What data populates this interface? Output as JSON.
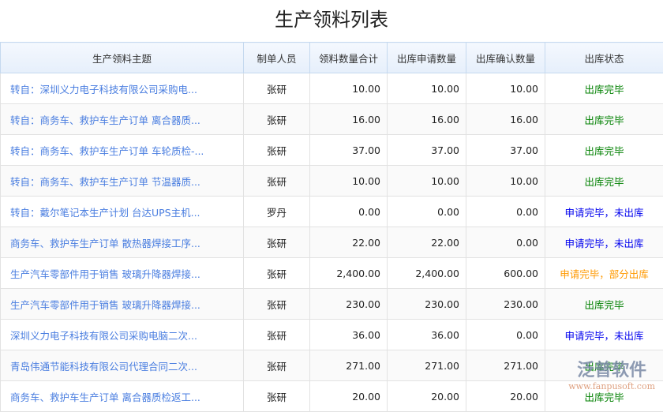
{
  "title": "生产领料列表",
  "columns": [
    "生产领料主题",
    "制单人员",
    "领料数量合计",
    "出库申请数量",
    "出库确认数量",
    "出库状态"
  ],
  "status_colors": {
    "出库完毕": "#008000",
    "申请完毕，未出库": "#0000ee",
    "申请完毕，部分出库": "#ff9900"
  },
  "rows": [
    {
      "subject": "转自：深圳义力电子科技有限公司采购电...",
      "creator": "张研",
      "total": "10.00",
      "apply": "10.00",
      "confirm": "10.00",
      "status": "出库完毕"
    },
    {
      "subject": "转自：商务车、救护车生产订单 离合器质...",
      "creator": "张研",
      "total": "16.00",
      "apply": "16.00",
      "confirm": "16.00",
      "status": "出库完毕"
    },
    {
      "subject": "转自：商务车、救护车生产订单 车轮质检-...",
      "creator": "张研",
      "total": "37.00",
      "apply": "37.00",
      "confirm": "37.00",
      "status": "出库完毕"
    },
    {
      "subject": "转自：商务车、救护车生产订单 节温器质...",
      "creator": "张研",
      "total": "10.00",
      "apply": "10.00",
      "confirm": "10.00",
      "status": "出库完毕"
    },
    {
      "subject": "转自：戴尔笔记本生产计划 台达UPS主机...",
      "creator": "罗丹",
      "total": "0.00",
      "apply": "0.00",
      "confirm": "0.00",
      "status": "申请完毕，未出库"
    },
    {
      "subject": "商务车、救护车生产订单 散热器焊接工序...",
      "creator": "张研",
      "total": "22.00",
      "apply": "22.00",
      "confirm": "0.00",
      "status": "申请完毕，未出库"
    },
    {
      "subject": "生产汽车零部件用于销售 玻璃升降器焊接...",
      "creator": "张研",
      "total": "2,400.00",
      "apply": "2,400.00",
      "confirm": "600.00",
      "status": "申请完毕，部分出库"
    },
    {
      "subject": "生产汽车零部件用于销售 玻璃升降器焊接...",
      "creator": "张研",
      "total": "230.00",
      "apply": "230.00",
      "confirm": "230.00",
      "status": "出库完毕"
    },
    {
      "subject": "深圳义力电子科技有限公司采购电脑二次...",
      "creator": "张研",
      "total": "36.00",
      "apply": "36.00",
      "confirm": "0.00",
      "status": "申请完毕，未出库"
    },
    {
      "subject": "青岛伟通节能科技有限公司代理合同二次...",
      "creator": "张研",
      "total": "271.00",
      "apply": "271.00",
      "confirm": "271.00",
      "status": "出库完毕"
    },
    {
      "subject": "商务车、救护车生产订单 离合器质检返工...",
      "creator": "张研",
      "total": "20.00",
      "apply": "20.00",
      "confirm": "20.00",
      "status": "出库完毕"
    }
  ],
  "watermark": {
    "brand": "泛普软件",
    "url": "www.fanpusoft.com"
  }
}
